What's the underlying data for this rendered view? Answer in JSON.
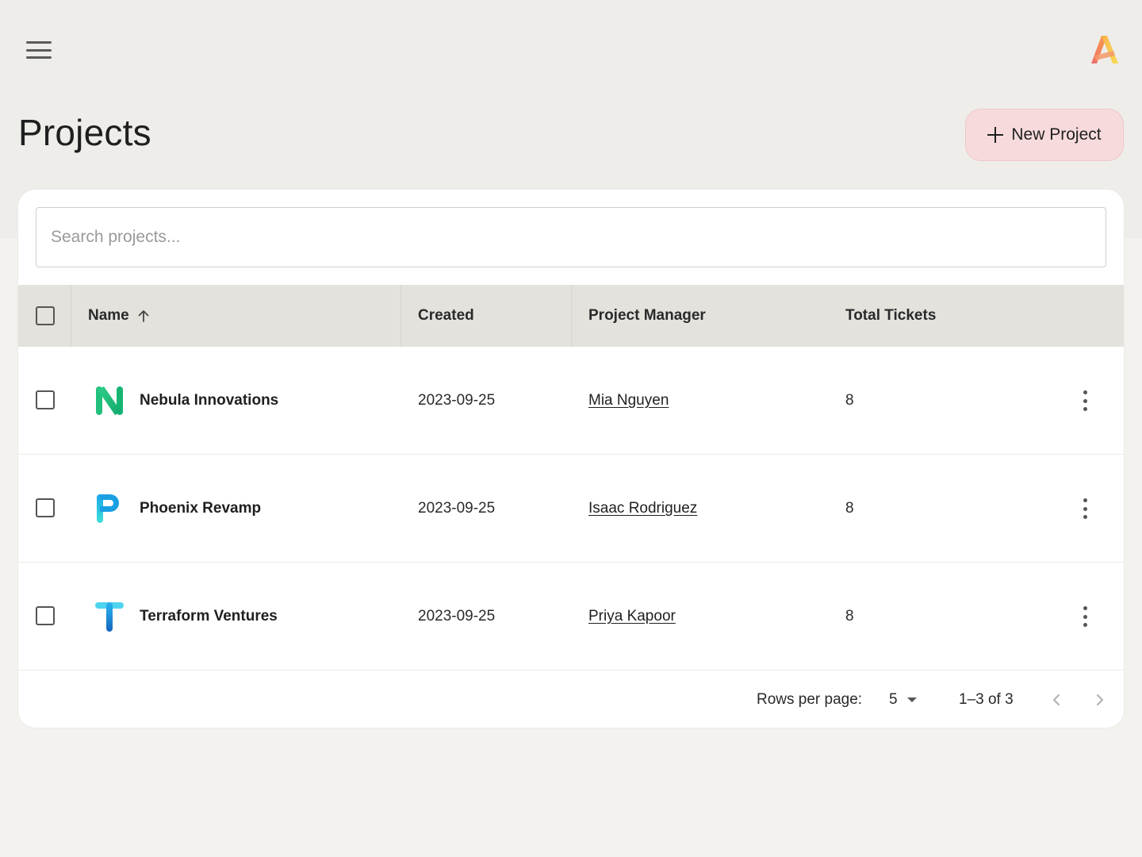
{
  "header": {
    "menu_icon": "hamburger-menu-icon",
    "logo_icon": "app-logo"
  },
  "page": {
    "title": "Projects",
    "new_button_label": "New Project"
  },
  "search": {
    "placeholder": "Search projects...",
    "value": ""
  },
  "table": {
    "columns": {
      "name": "Name",
      "created": "Created",
      "manager": "Project Manager",
      "tickets": "Total Tickets"
    },
    "sort": {
      "column": "Name",
      "direction": "ascending"
    },
    "rows": [
      {
        "icon": "nebula-logo",
        "name": "Nebula Innovations",
        "created": "2023-09-25",
        "manager": "Mia Nguyen",
        "tickets": "8"
      },
      {
        "icon": "phoenix-logo",
        "name": "Phoenix Revamp",
        "created": "2023-09-25",
        "manager": "Isaac Rodriguez",
        "tickets": "8"
      },
      {
        "icon": "terraform-logo",
        "name": "Terraform Ventures",
        "created": "2023-09-25",
        "manager": "Priya Kapoor",
        "tickets": "8"
      }
    ]
  },
  "pagination": {
    "rows_per_page_label": "Rows per page:",
    "rows_per_page_value": "5",
    "range_text": "1–3 of 3"
  },
  "colors": {
    "accent_button_bg": "#f7dbdc",
    "table_header_bg": "#e4e2dd",
    "page_bg": "#eeedea"
  }
}
